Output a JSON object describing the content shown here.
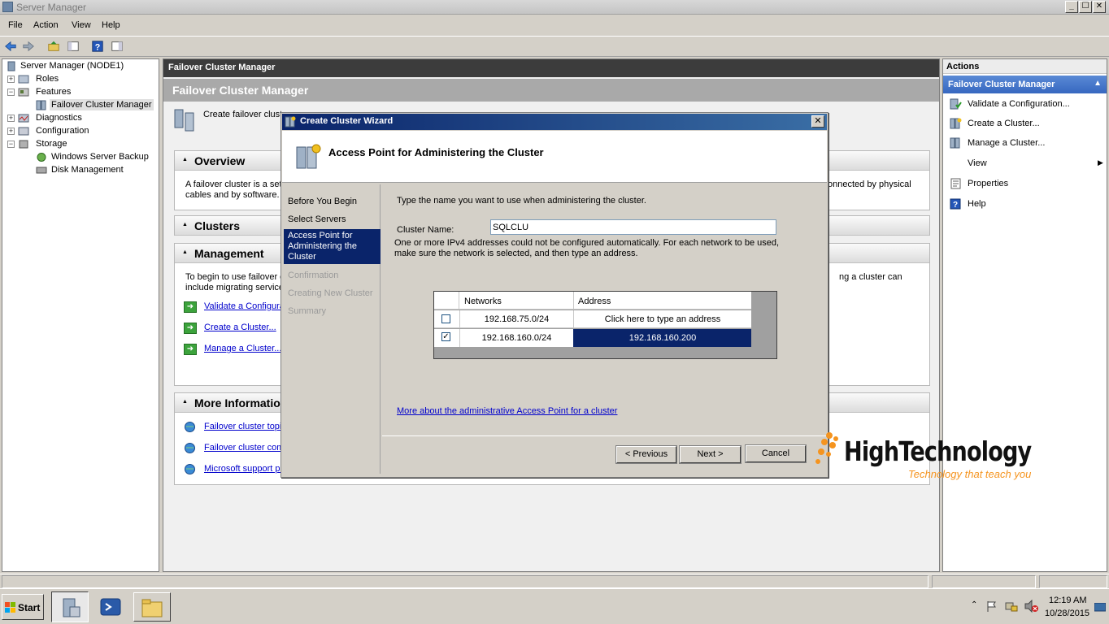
{
  "window": {
    "title": "Server Manager",
    "min": "_",
    "max": "☐",
    "close": "✕"
  },
  "menu": [
    "File",
    "Action",
    "View",
    "Help"
  ],
  "tree": {
    "root": "Server Manager (NODE1)",
    "roles": "Roles",
    "features": "Features",
    "fcm": "Failover Cluster Manager",
    "diagnostics": "Diagnostics",
    "configuration": "Configuration",
    "storage": "Storage",
    "wsb": "Windows Server Backup",
    "disk": "Disk Management",
    "plus": "+",
    "minus": "−"
  },
  "center": {
    "header": "Failover Cluster Manager",
    "band": "Failover Cluster Manager",
    "intro": "Create failover clust",
    "overview": {
      "title": "Overview",
      "text1": "A failover cluster is a set",
      "text1b": "onnected by physical",
      "text2": "cables and by software."
    },
    "clusters": {
      "title": "Clusters"
    },
    "management": {
      "title": "Management",
      "text1": "To begin to use failover c",
      "text1b": "ng a cluster can",
      "text2": "include migrating service",
      "links": [
        "Validate a Configura",
        "Create a Cluster...",
        "Manage a Cluster..."
      ]
    },
    "more": {
      "title": "More Informatio",
      "links": [
        "Failover cluster topic",
        "Failover cluster com",
        "Microsoft support pa"
      ]
    }
  },
  "actions": {
    "header": "Actions",
    "sub": "Failover Cluster Manager",
    "items": [
      "Validate a Configuration...",
      "Create a Cluster...",
      "Manage a Cluster...",
      "View",
      "Properties",
      "Help"
    ]
  },
  "dialog": {
    "title": "Create Cluster Wizard",
    "heading": "Access Point for Administering the Cluster",
    "nav": [
      "Before You Begin",
      "Select Servers",
      "Access Point for Administering the Cluster",
      "Confirmation",
      "Creating New Cluster",
      "Summary"
    ],
    "instruction": "Type the name you want to use when administering the cluster.",
    "cluster_name_label": "Cluster Name:",
    "cluster_name_value": "SQLCLU",
    "note": "One or more IPv4 addresses could not be configured automatically.  For each network to be used, make sure the network is selected, and then type an address.",
    "table": {
      "headers": [
        "Networks",
        "Address"
      ],
      "rows": [
        {
          "checked": false,
          "network": "192.168.75.0/24",
          "address": "Click here to type an address"
        },
        {
          "checked": true,
          "network": "192.168.160.0/24",
          "address": "192.168.160.200"
        }
      ]
    },
    "more_link": "More about the administrative Access Point for a cluster",
    "buttons": {
      "previous": "< Previous",
      "next": "Next >",
      "cancel": "Cancel"
    }
  },
  "watermark": {
    "brand": "HighTechnology",
    "tagline": "Technology that teach you"
  },
  "taskbar": {
    "start": "Start",
    "time": "12:19 AM",
    "date": "10/28/2015"
  },
  "colors": {
    "accent": "#0a246a",
    "selected": "#0a246a",
    "link": "#0000cc",
    "watermark_orange": "#f5941f"
  }
}
